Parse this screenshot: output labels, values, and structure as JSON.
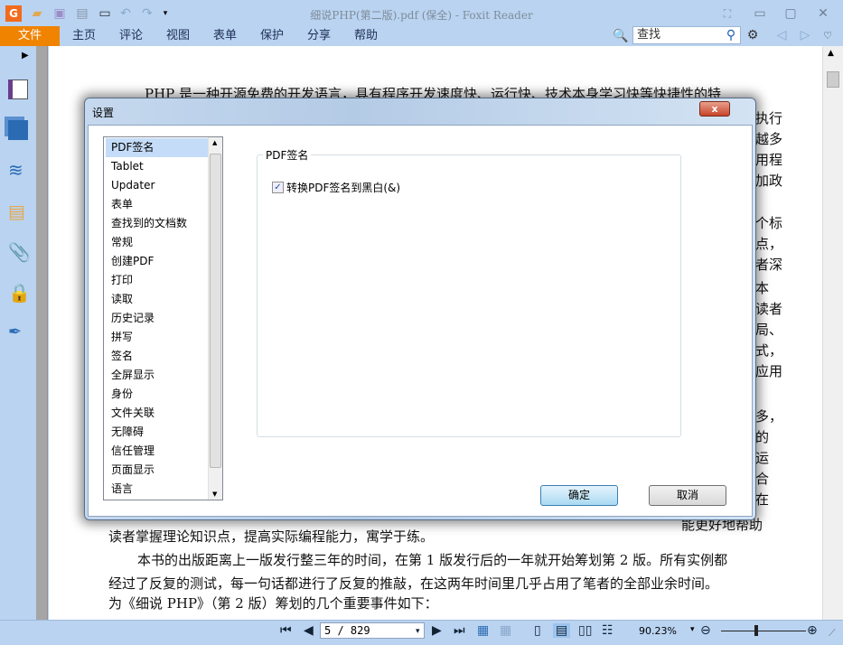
{
  "window": {
    "title": "细说PHP(第二版).pdf (保全) - Foxit Reader"
  },
  "menu": {
    "items": [
      "文件",
      "主页",
      "评论",
      "视图",
      "表单",
      "保护",
      "分享",
      "帮助"
    ]
  },
  "search": {
    "placeholder": "查找"
  },
  "document": {
    "line1": "PHP 是一种开源免费的开发语言，具有程序开发速度快、运行快、技术本身学习快等快捷性的特",
    "edge_fragments": [
      "执行",
      "越多",
      "用程",
      "加政",
      "个标",
      "点，",
      "者深",
      "本",
      "读者",
      "局、",
      "式，",
      "应用",
      "多，",
      "的",
      "运",
      "合",
      "在"
    ],
    "partial_line": "能更好地帮助",
    "lines": [
      "读者掌握理论知识点，提高实际编程能力，寓学于练。",
      "本书的出版距离上一版发行整三年的时间，在第 1 版发行后的一年就开始筹划第 2 版。所有实例都",
      "经过了反复的测试，每一句话都进行了反复的推敲，在这两年时间里几乎占用了笔者的全部业余时间。",
      "为《细说 PHP》（第 2 版）筹划的几个重要事件如下："
    ]
  },
  "dialog": {
    "title": "设置",
    "close_label": "x",
    "categories": [
      "PDF签名",
      "Tablet",
      "Updater",
      "表单",
      "查找到的文档数",
      "常规",
      "创建PDF",
      "打印",
      "读取",
      "历史记录",
      "拼写",
      "签名",
      "全屏显示",
      "身份",
      "文件关联",
      "无障碍",
      "信任管理",
      "页面显示",
      "语言"
    ],
    "selected": "PDF签名",
    "group_title": "PDF签名",
    "checkbox_label": "转换PDF签名到黑白(&)",
    "checkbox_checked": true,
    "ok": "确定",
    "cancel": "取消"
  },
  "status": {
    "page": "5 / 829",
    "zoom": "90.23%"
  },
  "colors": {
    "accent": "#f08300",
    "chrome": "#b9d3f1"
  }
}
